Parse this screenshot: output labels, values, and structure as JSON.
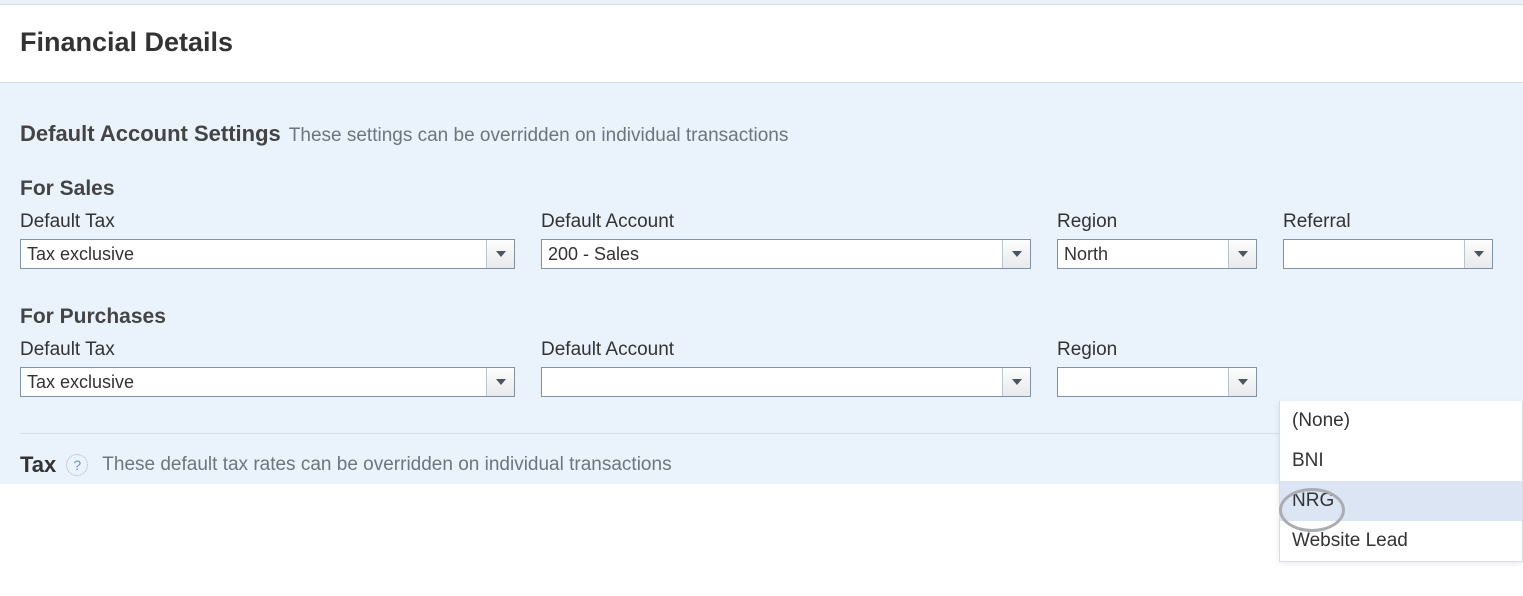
{
  "header": {
    "title": "Financial Details"
  },
  "default_settings": {
    "heading": "Default Account Settings",
    "subtext": "These settings can be overridden on individual transactions"
  },
  "sales": {
    "title": "For Sales",
    "default_tax_label": "Default Tax",
    "default_tax_value": "Tax exclusive",
    "default_account_label": "Default Account",
    "default_account_value": "200 - Sales",
    "region_label": "Region",
    "region_value": "North",
    "referral_label": "Referral",
    "referral_value": ""
  },
  "purchases": {
    "title": "For Purchases",
    "default_tax_label": "Default Tax",
    "default_tax_value": "Tax exclusive",
    "default_account_label": "Default Account",
    "default_account_value": "",
    "region_label": "Region",
    "region_value": ""
  },
  "referral_dropdown": {
    "options": [
      "(None)",
      "BNI",
      "NRG",
      "Website Lead"
    ],
    "highlighted": "NRG"
  },
  "tax": {
    "title": "Tax",
    "help_glyph": "?",
    "subtext": "These default tax rates can be overridden on individual transactions"
  }
}
